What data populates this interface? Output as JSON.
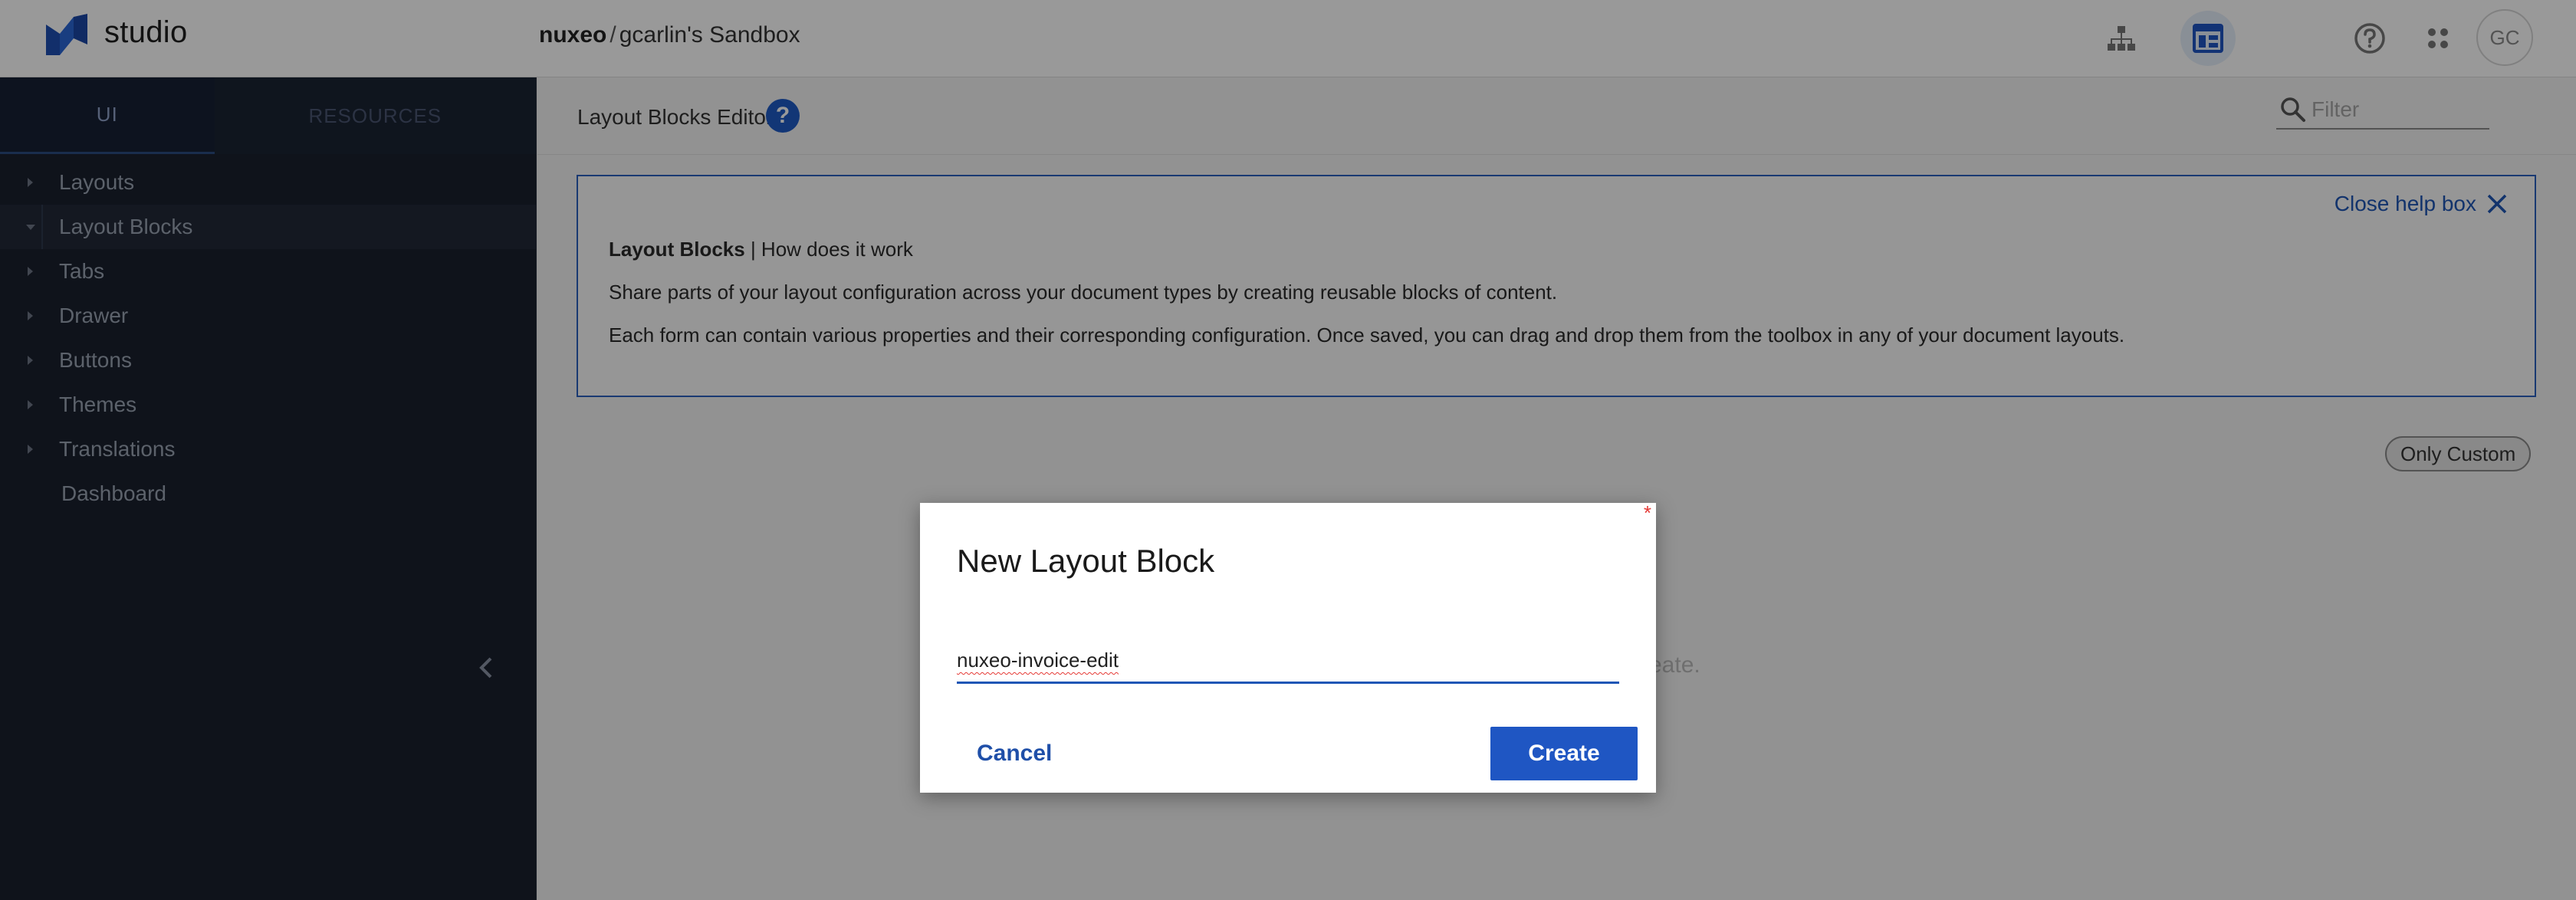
{
  "header": {
    "brand": "studio",
    "breadcrumb_org": "nuxeo",
    "breadcrumb_sep": "/",
    "breadcrumb_project": "gcarlin's Sandbox",
    "avatar_initials": "GC",
    "icons": [
      "nuxeo-logo-icon",
      "hierarchy-icon",
      "layout-editor-icon",
      "help-circle-icon",
      "apps-grid-icon"
    ]
  },
  "sidebar": {
    "tabs": [
      {
        "label": "UI",
        "active": true
      },
      {
        "label": "RESOURCES",
        "active": false
      }
    ],
    "items": [
      {
        "label": "Layouts",
        "expanded": false
      },
      {
        "label": "Layout Blocks",
        "expanded": true,
        "selected": true
      },
      {
        "label": "Tabs",
        "expanded": false
      },
      {
        "label": "Drawer",
        "expanded": false
      },
      {
        "label": "Buttons",
        "expanded": false
      },
      {
        "label": "Themes",
        "expanded": false
      },
      {
        "label": "Translations",
        "expanded": false
      },
      {
        "label": "Dashboard",
        "leaf": true
      }
    ]
  },
  "main": {
    "title": "Layout Blocks Editor",
    "help_symbol": "?",
    "filter_placeholder": "Filter",
    "helpbox": {
      "close_label": "Close help box",
      "heading_bold": "Layout Blocks",
      "heading_rest": " | How does it work",
      "line1": "Share parts of your layout configuration across your document types by creating reusable blocks of content.",
      "line2": "Each form can contain various properties and their corresponding configuration. Once saved, you can drag and drop them from the toolbox in any of your document layouts."
    },
    "only_custom_label": "Only Custom",
    "empty_hint_fragment": "reate."
  },
  "dialog": {
    "required_mark": "*",
    "title": "New Layout Block",
    "input_value": "nuxeo-invoice-edit",
    "cancel_label": "Cancel",
    "create_label": "Create"
  },
  "colors": {
    "accent": "#1f56c3",
    "sidebar_bg": "#19202d",
    "help_border": "#2a5fbf"
  }
}
